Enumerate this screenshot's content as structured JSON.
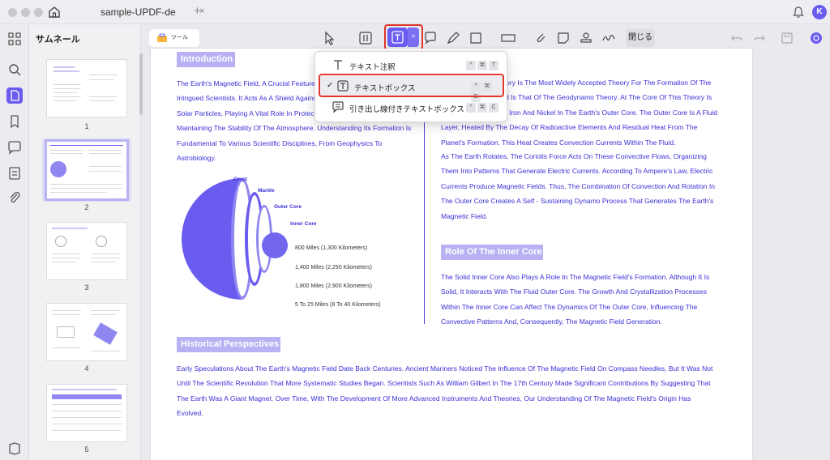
{
  "window": {
    "tab_title": "sample-UPDF-de",
    "tab_close": "×",
    "tab_add": "+",
    "avatar_initial": "K"
  },
  "sidebar": {
    "title": "サムネール",
    "thumbnails": [
      {
        "page": "1"
      },
      {
        "page": "2",
        "selected": true
      },
      {
        "page": "3"
      },
      {
        "page": "4"
      },
      {
        "page": "5"
      }
    ]
  },
  "toolbar": {
    "tools_chip": "ツール",
    "close_label": "閉じる",
    "active_tool": "text-box-icon"
  },
  "dropdown": {
    "items": [
      {
        "label": "テキスト注釈",
        "keys": [
          "^",
          "⌘",
          "T"
        ],
        "selected": false
      },
      {
        "label": "テキストボックス",
        "keys": [
          "^",
          "⌘",
          "B"
        ],
        "selected": true
      },
      {
        "label": "引き出し線付きテキストボックス",
        "keys": [
          "^",
          "⌘",
          "C"
        ],
        "selected": false
      }
    ],
    "check_mark": "✓"
  },
  "document": {
    "intro_heading": "Introduction",
    "intro_text": "The Earth's Magnetic Field, A Crucial Feature Of Our Planet, Has Long Intrigued Scientists. It Acts As A Shield Against Harmful Cosmic Radiation And Solar Particles, Playing A Vital Role In Protecting Life On Earth And Maintaining The Stability Of The Atmosphere. Understanding Its Formation Is Fundamental To Various Scientific Disciplines, From Geophysics To Astrobiology.",
    "right_text_1": "The Geodynamo Theory Is The Most Widely Accepted Theory For The Formation Of The Earth's Magnetic Field Is That Of The Geodynamo Theory. At The Core Of This Theory Is The Motion Of Molten Iron And Nickel In The Earth's Outer Core. The Outer Core Is A Fluid Layer, Heated By The Decay Of Radioactive Elements And Residual Heat From The Planet's Formation. This Heat Creates Convection Currents Within The Fluid.",
    "right_text_2": "As The Earth Rotates, The Coriolis Force Acts On These Convective Flows, Organizing Them Into Patterns That Generate Electric Currents. According To Ampere's Law, Electric Currents Produce Magnetic Fields. Thus, The Combination Of Convection And Rotation In The Outer Core Creates A Self - Sustaining Dynamo Process That Generates The Earth's Magnetic Field.",
    "inner_core_heading": "Role Of The Inner Core",
    "inner_core_text": "The Solid Inner Core Also Plays A Role In The Magnetic Field's Formation. Although It Is Solid, It Interacts With The Fluid Outer Core. The Growth And Crystallization Processes Within The Inner Core Can Affect The Dynamics Of The Outer Core, Influencing The Convective Patterns And, Consequently, The Magnetic Field Generation.",
    "historical_heading": "Historical Perspectives",
    "historical_text": "Early Speculations About The Earth's Magnetic Field Date Back Centuries. Ancient Mariners Noticed The Influence Of The Magnetic Field On Compass Needles, But It Was Not Until The Scientific Revolution That More Systematic Studies Began. Scientists Such As William Gilbert In The 17th Century Made Significant Contributions By Suggesting That The Earth Was A Giant Magnet. Over Time, With The Development Of More Advanced Instruments And Theories, Our Understanding Of The Magnetic Field's Origin Has Evolved.",
    "diagram": {
      "crust": "Crust",
      "mantle": "Mantle",
      "outer_core": "Outer Core",
      "inner_core": "Inner Core",
      "d1": "800 Miles (1,300 Kilometers)",
      "d2": "1,400 Miles (2,250 Kilometers)",
      "d3": "1,800 Miles (2,900 Kilometers)",
      "d4": "5 To 25 Miles (8 To 40 Kilometers)"
    }
  },
  "colors": {
    "accent": "#6b5cf0",
    "heading_bg": "#b8b1f3",
    "text_blue": "#3b2fd6",
    "highlight_red": "#e0362b"
  }
}
